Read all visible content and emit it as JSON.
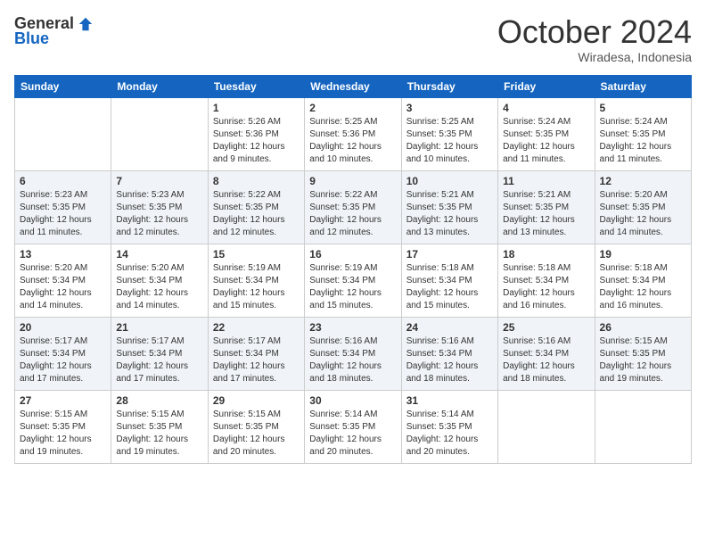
{
  "logo": {
    "general": "General",
    "blue": "Blue"
  },
  "header": {
    "month": "October 2024",
    "location": "Wiradesa, Indonesia"
  },
  "days_of_week": [
    "Sunday",
    "Monday",
    "Tuesday",
    "Wednesday",
    "Thursday",
    "Friday",
    "Saturday"
  ],
  "weeks": [
    [
      {
        "day": null,
        "sunrise": null,
        "sunset": null,
        "daylight": null
      },
      {
        "day": null,
        "sunrise": null,
        "sunset": null,
        "daylight": null
      },
      {
        "day": "1",
        "sunrise": "Sunrise: 5:26 AM",
        "sunset": "Sunset: 5:36 PM",
        "daylight": "Daylight: 12 hours and 9 minutes."
      },
      {
        "day": "2",
        "sunrise": "Sunrise: 5:25 AM",
        "sunset": "Sunset: 5:36 PM",
        "daylight": "Daylight: 12 hours and 10 minutes."
      },
      {
        "day": "3",
        "sunrise": "Sunrise: 5:25 AM",
        "sunset": "Sunset: 5:35 PM",
        "daylight": "Daylight: 12 hours and 10 minutes."
      },
      {
        "day": "4",
        "sunrise": "Sunrise: 5:24 AM",
        "sunset": "Sunset: 5:35 PM",
        "daylight": "Daylight: 12 hours and 11 minutes."
      },
      {
        "day": "5",
        "sunrise": "Sunrise: 5:24 AM",
        "sunset": "Sunset: 5:35 PM",
        "daylight": "Daylight: 12 hours and 11 minutes."
      }
    ],
    [
      {
        "day": "6",
        "sunrise": "Sunrise: 5:23 AM",
        "sunset": "Sunset: 5:35 PM",
        "daylight": "Daylight: 12 hours and 11 minutes."
      },
      {
        "day": "7",
        "sunrise": "Sunrise: 5:23 AM",
        "sunset": "Sunset: 5:35 PM",
        "daylight": "Daylight: 12 hours and 12 minutes."
      },
      {
        "day": "8",
        "sunrise": "Sunrise: 5:22 AM",
        "sunset": "Sunset: 5:35 PM",
        "daylight": "Daylight: 12 hours and 12 minutes."
      },
      {
        "day": "9",
        "sunrise": "Sunrise: 5:22 AM",
        "sunset": "Sunset: 5:35 PM",
        "daylight": "Daylight: 12 hours and 12 minutes."
      },
      {
        "day": "10",
        "sunrise": "Sunrise: 5:21 AM",
        "sunset": "Sunset: 5:35 PM",
        "daylight": "Daylight: 12 hours and 13 minutes."
      },
      {
        "day": "11",
        "sunrise": "Sunrise: 5:21 AM",
        "sunset": "Sunset: 5:35 PM",
        "daylight": "Daylight: 12 hours and 13 minutes."
      },
      {
        "day": "12",
        "sunrise": "Sunrise: 5:20 AM",
        "sunset": "Sunset: 5:35 PM",
        "daylight": "Daylight: 12 hours and 14 minutes."
      }
    ],
    [
      {
        "day": "13",
        "sunrise": "Sunrise: 5:20 AM",
        "sunset": "Sunset: 5:34 PM",
        "daylight": "Daylight: 12 hours and 14 minutes."
      },
      {
        "day": "14",
        "sunrise": "Sunrise: 5:20 AM",
        "sunset": "Sunset: 5:34 PM",
        "daylight": "Daylight: 12 hours and 14 minutes."
      },
      {
        "day": "15",
        "sunrise": "Sunrise: 5:19 AM",
        "sunset": "Sunset: 5:34 PM",
        "daylight": "Daylight: 12 hours and 15 minutes."
      },
      {
        "day": "16",
        "sunrise": "Sunrise: 5:19 AM",
        "sunset": "Sunset: 5:34 PM",
        "daylight": "Daylight: 12 hours and 15 minutes."
      },
      {
        "day": "17",
        "sunrise": "Sunrise: 5:18 AM",
        "sunset": "Sunset: 5:34 PM",
        "daylight": "Daylight: 12 hours and 15 minutes."
      },
      {
        "day": "18",
        "sunrise": "Sunrise: 5:18 AM",
        "sunset": "Sunset: 5:34 PM",
        "daylight": "Daylight: 12 hours and 16 minutes."
      },
      {
        "day": "19",
        "sunrise": "Sunrise: 5:18 AM",
        "sunset": "Sunset: 5:34 PM",
        "daylight": "Daylight: 12 hours and 16 minutes."
      }
    ],
    [
      {
        "day": "20",
        "sunrise": "Sunrise: 5:17 AM",
        "sunset": "Sunset: 5:34 PM",
        "daylight": "Daylight: 12 hours and 17 minutes."
      },
      {
        "day": "21",
        "sunrise": "Sunrise: 5:17 AM",
        "sunset": "Sunset: 5:34 PM",
        "daylight": "Daylight: 12 hours and 17 minutes."
      },
      {
        "day": "22",
        "sunrise": "Sunrise: 5:17 AM",
        "sunset": "Sunset: 5:34 PM",
        "daylight": "Daylight: 12 hours and 17 minutes."
      },
      {
        "day": "23",
        "sunrise": "Sunrise: 5:16 AM",
        "sunset": "Sunset: 5:34 PM",
        "daylight": "Daylight: 12 hours and 18 minutes."
      },
      {
        "day": "24",
        "sunrise": "Sunrise: 5:16 AM",
        "sunset": "Sunset: 5:34 PM",
        "daylight": "Daylight: 12 hours and 18 minutes."
      },
      {
        "day": "25",
        "sunrise": "Sunrise: 5:16 AM",
        "sunset": "Sunset: 5:34 PM",
        "daylight": "Daylight: 12 hours and 18 minutes."
      },
      {
        "day": "26",
        "sunrise": "Sunrise: 5:15 AM",
        "sunset": "Sunset: 5:35 PM",
        "daylight": "Daylight: 12 hours and 19 minutes."
      }
    ],
    [
      {
        "day": "27",
        "sunrise": "Sunrise: 5:15 AM",
        "sunset": "Sunset: 5:35 PM",
        "daylight": "Daylight: 12 hours and 19 minutes."
      },
      {
        "day": "28",
        "sunrise": "Sunrise: 5:15 AM",
        "sunset": "Sunset: 5:35 PM",
        "daylight": "Daylight: 12 hours and 19 minutes."
      },
      {
        "day": "29",
        "sunrise": "Sunrise: 5:15 AM",
        "sunset": "Sunset: 5:35 PM",
        "daylight": "Daylight: 12 hours and 20 minutes."
      },
      {
        "day": "30",
        "sunrise": "Sunrise: 5:14 AM",
        "sunset": "Sunset: 5:35 PM",
        "daylight": "Daylight: 12 hours and 20 minutes."
      },
      {
        "day": "31",
        "sunrise": "Sunrise: 5:14 AM",
        "sunset": "Sunset: 5:35 PM",
        "daylight": "Daylight: 12 hours and 20 minutes."
      },
      {
        "day": null,
        "sunrise": null,
        "sunset": null,
        "daylight": null
      },
      {
        "day": null,
        "sunrise": null,
        "sunset": null,
        "daylight": null
      }
    ]
  ]
}
